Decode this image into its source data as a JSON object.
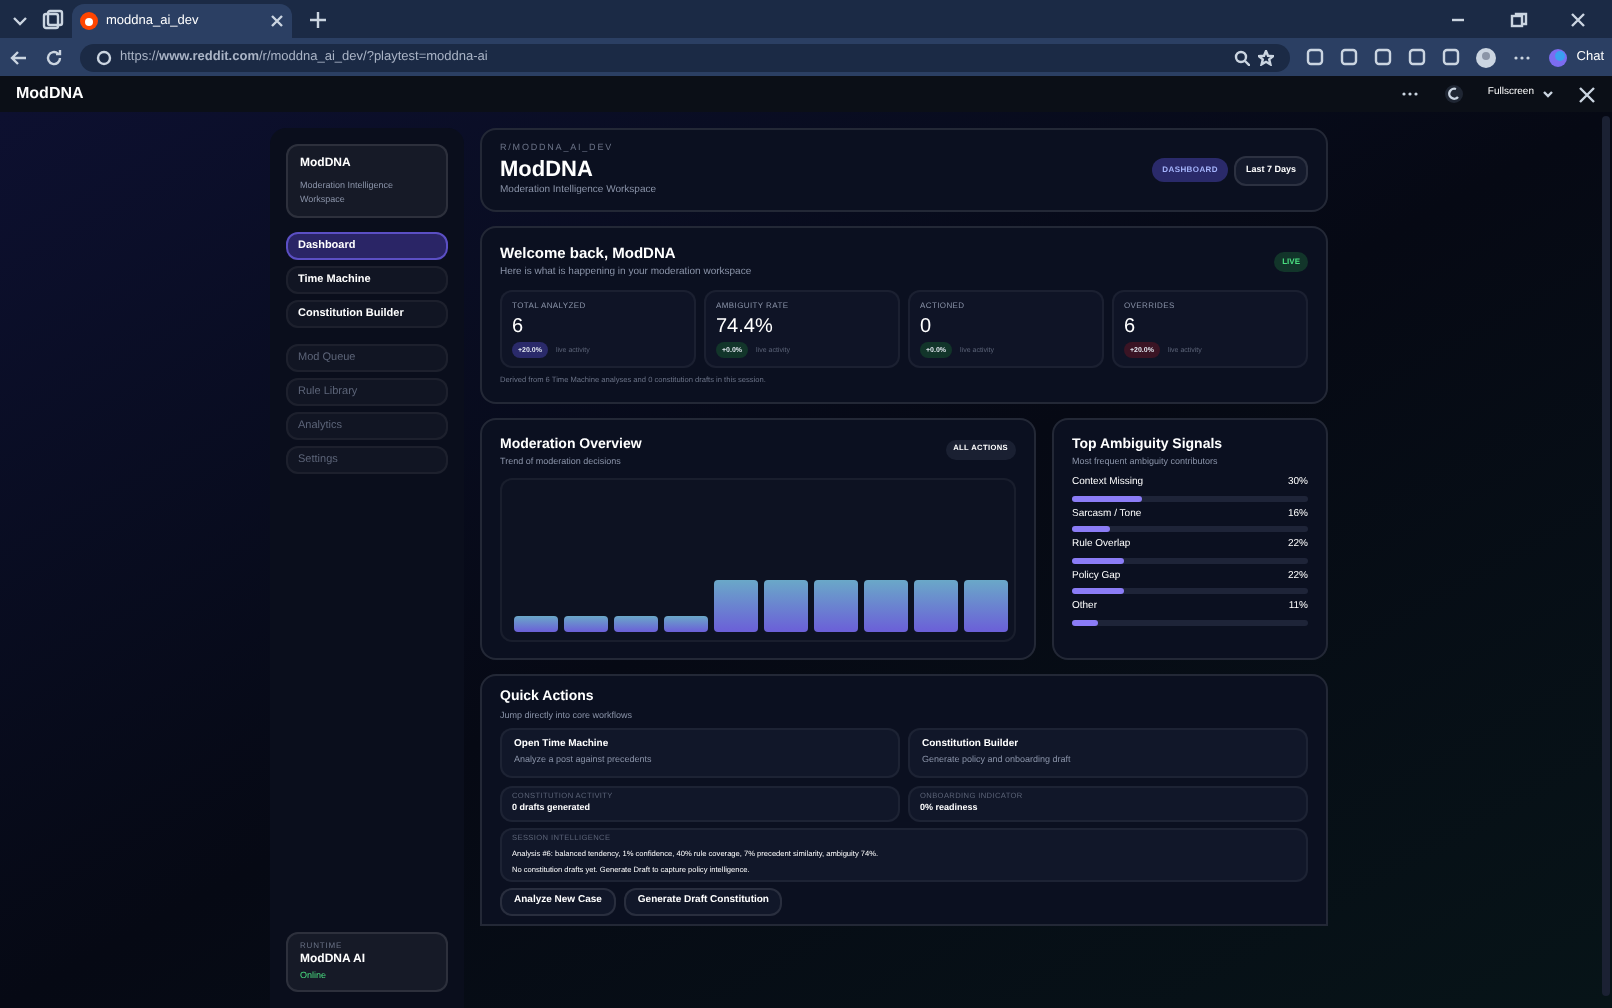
{
  "browser": {
    "tabs": [
      {
        "title": "moddna_ai_dev",
        "selected": true
      }
    ],
    "url": "https://**www.reddit.com**/r/moddna_ai_dev/?playtest=moddna-ai",
    "chat_label": "Chat"
  },
  "app_header": {
    "title": "ModDNA",
    "fullscreen_label": "Fullscreen"
  },
  "sidebar": {
    "brand": {
      "title": "ModDNA",
      "subtitle": "Moderation Intelligence Workspace"
    },
    "items": [
      {
        "label": "Dashboard",
        "selected": true,
        "disabled": false
      },
      {
        "label": "Time Machine",
        "selected": false,
        "disabled": false
      },
      {
        "label": "Constitution Builder",
        "selected": false,
        "disabled": false
      },
      {
        "label": "Mod Queue",
        "selected": false,
        "disabled": true
      },
      {
        "label": "Rule Library",
        "selected": false,
        "disabled": true
      },
      {
        "label": "Analytics",
        "selected": false,
        "disabled": true
      },
      {
        "label": "Settings",
        "selected": false,
        "disabled": true
      }
    ],
    "runtime": {
      "label": "RUNTIME",
      "name": "ModDNA AI",
      "status": "Online"
    }
  },
  "header": {
    "eyebrow": "R/MODDNA_AI_DEV",
    "title": "ModDNA",
    "subtitle": "Moderation Intelligence Workspace",
    "badge": "DASHBOARD",
    "range_button": "Last 7 Days"
  },
  "welcome": {
    "title": "Welcome back, ModDNA",
    "subtitle": "Here is what is happening in your moderation workspace",
    "live_badge": "LIVE",
    "stats": [
      {
        "label": "TOTAL ANALYZED",
        "value": "6",
        "change": "+20.0%",
        "color": "#2a2a6a",
        "note": "live activity"
      },
      {
        "label": "AMBIGUITY RATE",
        "value": "74.4%",
        "change": "+0.0%",
        "color": "#12352a",
        "note": "live activity"
      },
      {
        "label": "ACTIONED",
        "value": "0",
        "change": "+0.0%",
        "color": "#12352a",
        "note": "live activity"
      },
      {
        "label": "OVERRIDES",
        "value": "6",
        "change": "+20.0%",
        "color": "#3a1424",
        "note": "live activity"
      }
    ],
    "footnote": "Derived from 6 Time Machine analyses and 0 constitution drafts in this session."
  },
  "overview": {
    "title": "Moderation Overview",
    "subtitle": "Trend of moderation decisions",
    "filter_button": "ALL ACTIONS"
  },
  "signals": {
    "title": "Top Ambiguity Signals",
    "subtitle": "Most frequent ambiguity contributors",
    "items": [
      {
        "label": "Context Missing",
        "value": "30%",
        "level": 0.3
      },
      {
        "label": "Sarcasm / Tone",
        "value": "16%",
        "level": 0.16
      },
      {
        "label": "Rule Overlap",
        "value": "22%",
        "level": 0.22
      },
      {
        "label": "Policy Gap",
        "value": "22%",
        "level": 0.22
      },
      {
        "label": "Other",
        "value": "11%",
        "level": 0.11
      }
    ]
  },
  "quick_actions": {
    "title": "Quick Actions",
    "subtitle": "Jump directly into core workflows",
    "actions": [
      {
        "title": "Open Time Machine",
        "description": "Analyze a post against precedents"
      },
      {
        "title": "Constitution Builder",
        "description": "Generate policy and onboarding draft"
      }
    ],
    "metrics": [
      {
        "label": "CONSTITUTION ACTIVITY",
        "value": "0 drafts generated"
      },
      {
        "label": "ONBOARDING INDICATOR",
        "value": "0% readiness"
      }
    ],
    "session": {
      "label": "SESSION INTELLIGENCE",
      "lines": [
        "Analysis #6: balanced tendency, 1% confidence, 40% rule coverage, 7% precedent similarity, ambiguity 74%.",
        "No constitution drafts yet. Generate Draft to capture policy intelligence."
      ]
    },
    "buttons": [
      "Analyze New Case",
      "Generate Draft Constitution"
    ]
  }
}
